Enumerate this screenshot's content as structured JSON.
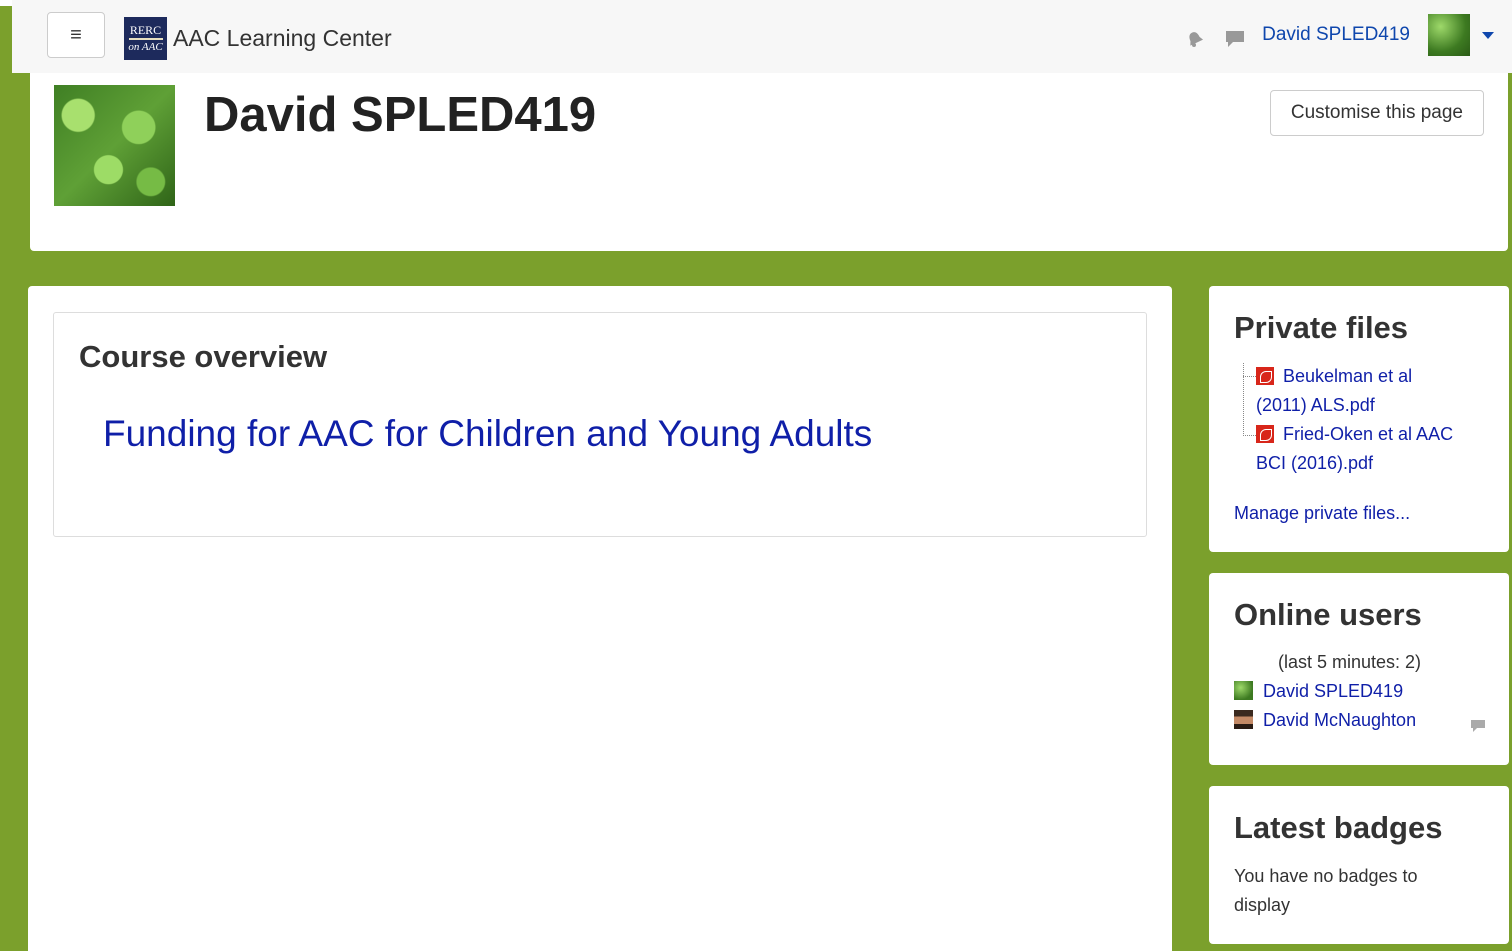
{
  "navbar": {
    "menu_icon": "hamburger-icon",
    "logo_line1": "RERC",
    "logo_line2": "on AAC",
    "site_name": "AAC Learning Center",
    "user_name": "David SPLED419"
  },
  "header": {
    "title": "David SPLED419",
    "customise_label": "Customise this page"
  },
  "course_overview": {
    "heading": "Course overview",
    "courses": [
      "Funding for AAC for Children and Young Adults"
    ]
  },
  "private_files": {
    "heading": "Private files",
    "files": [
      {
        "line1": "Beukelman et al",
        "line2": "(2011) ALS.pdf"
      },
      {
        "line1": "Fried-Oken et al AAC",
        "line2": "BCI (2016).pdf"
      }
    ],
    "manage_label": "Manage private files..."
  },
  "online_users": {
    "heading": "Online users",
    "subtitle": "(last 5 minutes: 2)",
    "users": [
      "David SPLED419",
      "David McNaughton"
    ]
  },
  "latest_badges": {
    "heading": "Latest badges",
    "line1": "You have no badges to",
    "line2": "display"
  },
  "colors": {
    "page_bg": "#7ba02c",
    "link": "#0f1fa8",
    "nav_link": "#0f47ad"
  }
}
